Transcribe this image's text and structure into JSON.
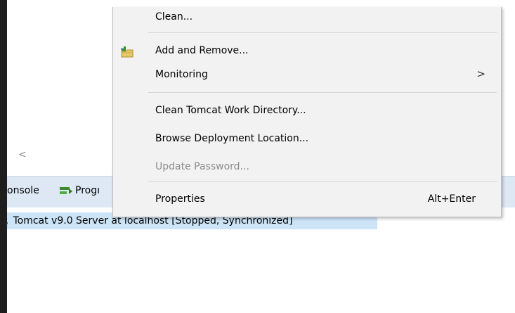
{
  "context_menu": {
    "clean": "Clean...",
    "add_remove": "Add and Remove...",
    "monitoring": "Monitoring",
    "monitoring_arrow": ">",
    "clean_tomcat_work": "Clean Tomcat Work Directory...",
    "browse_deployment": "Browse Deployment Location...",
    "update_password": "Update Password...",
    "properties": "Properties",
    "properties_shortcut": "Alt+Enter"
  },
  "background": {
    "scroll_left_arrow": "<",
    "tab_console": "onsole",
    "tab_progress": "Progı",
    "server_row_prefix": ",",
    "server_entry": "Tomcat v9.0 Server at localhost  [Stopped, Synchronized]"
  }
}
